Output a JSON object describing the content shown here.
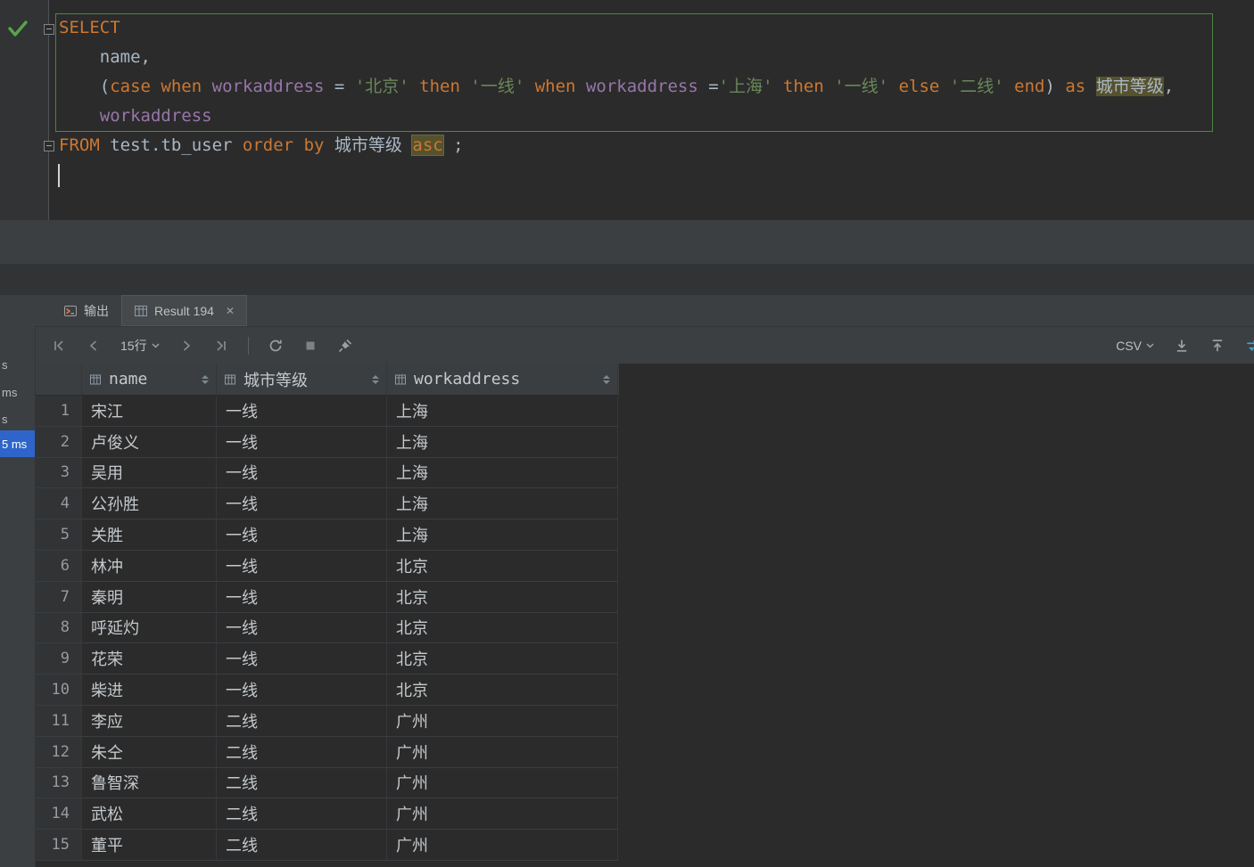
{
  "editor": {
    "lines": [
      {
        "tokens": [
          {
            "t": "SELECT",
            "c": "kw"
          }
        ]
      },
      {
        "tokens": [
          {
            "t": "    name,",
            "c": "pl"
          }
        ]
      },
      {
        "tokens": [
          {
            "t": "    (",
            "c": "pl"
          },
          {
            "t": "case",
            "c": "kw"
          },
          {
            "t": " ",
            "c": "pl"
          },
          {
            "t": "when",
            "c": "kw"
          },
          {
            "t": " ",
            "c": "pl"
          },
          {
            "t": "workaddress",
            "c": "fld"
          },
          {
            "t": " = ",
            "c": "pl"
          },
          {
            "t": "'北京'",
            "c": "str"
          },
          {
            "t": " ",
            "c": "pl"
          },
          {
            "t": "then",
            "c": "kw"
          },
          {
            "t": " ",
            "c": "pl"
          },
          {
            "t": "'一线'",
            "c": "str"
          },
          {
            "t": " ",
            "c": "pl"
          },
          {
            "t": "when",
            "c": "kw"
          },
          {
            "t": " ",
            "c": "pl"
          },
          {
            "t": "workaddress",
            "c": "fld"
          },
          {
            "t": " =",
            "c": "pl"
          },
          {
            "t": "'上海'",
            "c": "str"
          },
          {
            "t": " ",
            "c": "pl"
          },
          {
            "t": "then",
            "c": "kw"
          },
          {
            "t": " ",
            "c": "pl"
          },
          {
            "t": "'一线'",
            "c": "str"
          },
          {
            "t": " ",
            "c": "pl"
          },
          {
            "t": "else",
            "c": "kw"
          },
          {
            "t": " ",
            "c": "pl"
          },
          {
            "t": "'二线'",
            "c": "str"
          },
          {
            "t": " ",
            "c": "pl"
          },
          {
            "t": "end",
            "c": "kw"
          },
          {
            "t": ") ",
            "c": "pl"
          },
          {
            "t": "as",
            "c": "kw"
          },
          {
            "t": " ",
            "c": "pl"
          },
          {
            "t": "城市等级",
            "c": "hl"
          },
          {
            "t": ",",
            "c": "pl"
          }
        ]
      },
      {
        "tokens": [
          {
            "t": "    ",
            "c": "pl"
          },
          {
            "t": "workaddress",
            "c": "fld"
          }
        ]
      },
      {
        "tokens": [
          {
            "t": "FROM",
            "c": "kw"
          },
          {
            "t": " test.tb_user ",
            "c": "pl"
          },
          {
            "t": "order",
            "c": "kw"
          },
          {
            "t": " ",
            "c": "pl"
          },
          {
            "t": "by",
            "c": "kw"
          },
          {
            "t": " ",
            "c": "pl"
          },
          {
            "t": "城市等级 ",
            "c": "pl"
          },
          {
            "t": "asc",
            "c": "kwhl"
          },
          {
            "t": " ;",
            "c": "pl"
          }
        ]
      },
      {
        "tokens": []
      }
    ]
  },
  "tabs": {
    "output": {
      "label": "输出"
    },
    "result": {
      "label": "Result 194",
      "close": "✕"
    }
  },
  "toolbar": {
    "page_size": "15行",
    "export_format": "CSV"
  },
  "left_panel": {
    "items": [
      {
        "label": "s",
        "selected": false
      },
      {
        "label": "ms",
        "selected": false
      },
      {
        "label": "s",
        "selected": false
      },
      {
        "label": "5 ms",
        "selected": true
      }
    ]
  },
  "table": {
    "columns": [
      "name",
      "城市等级",
      "workaddress"
    ],
    "rows": [
      {
        "num": 1,
        "cells": [
          "宋江",
          "一线",
          "上海"
        ]
      },
      {
        "num": 2,
        "cells": [
          "卢俊义",
          "一线",
          "上海"
        ]
      },
      {
        "num": 3,
        "cells": [
          "吴用",
          "一线",
          "上海"
        ]
      },
      {
        "num": 4,
        "cells": [
          "公孙胜",
          "一线",
          "上海"
        ]
      },
      {
        "num": 5,
        "cells": [
          "关胜",
          "一线",
          "上海"
        ]
      },
      {
        "num": 6,
        "cells": [
          "林冲",
          "一线",
          "北京"
        ]
      },
      {
        "num": 7,
        "cells": [
          "秦明",
          "一线",
          "北京"
        ]
      },
      {
        "num": 8,
        "cells": [
          "呼延灼",
          "一线",
          "北京"
        ]
      },
      {
        "num": 9,
        "cells": [
          "花荣",
          "一线",
          "北京"
        ]
      },
      {
        "num": 10,
        "cells": [
          "柴进",
          "一线",
          "北京"
        ]
      },
      {
        "num": 11,
        "cells": [
          "李应",
          "二线",
          "广州"
        ]
      },
      {
        "num": 12,
        "cells": [
          "朱仝",
          "二线",
          "广州"
        ]
      },
      {
        "num": 13,
        "cells": [
          "鲁智深",
          "二线",
          "广州"
        ]
      },
      {
        "num": 14,
        "cells": [
          "武松",
          "二线",
          "广州"
        ]
      },
      {
        "num": 15,
        "cells": [
          "董平",
          "二线",
          "广州"
        ]
      }
    ]
  },
  "colors": {
    "keyword": "#CC7832",
    "plain": "#A9B7C6",
    "field": "#9876AA",
    "string": "#6A8759",
    "highlight_bg": "#55522D",
    "statement_border": "#4C8647",
    "selection_blue": "#2F65CA",
    "check_green": "#57A64A"
  }
}
